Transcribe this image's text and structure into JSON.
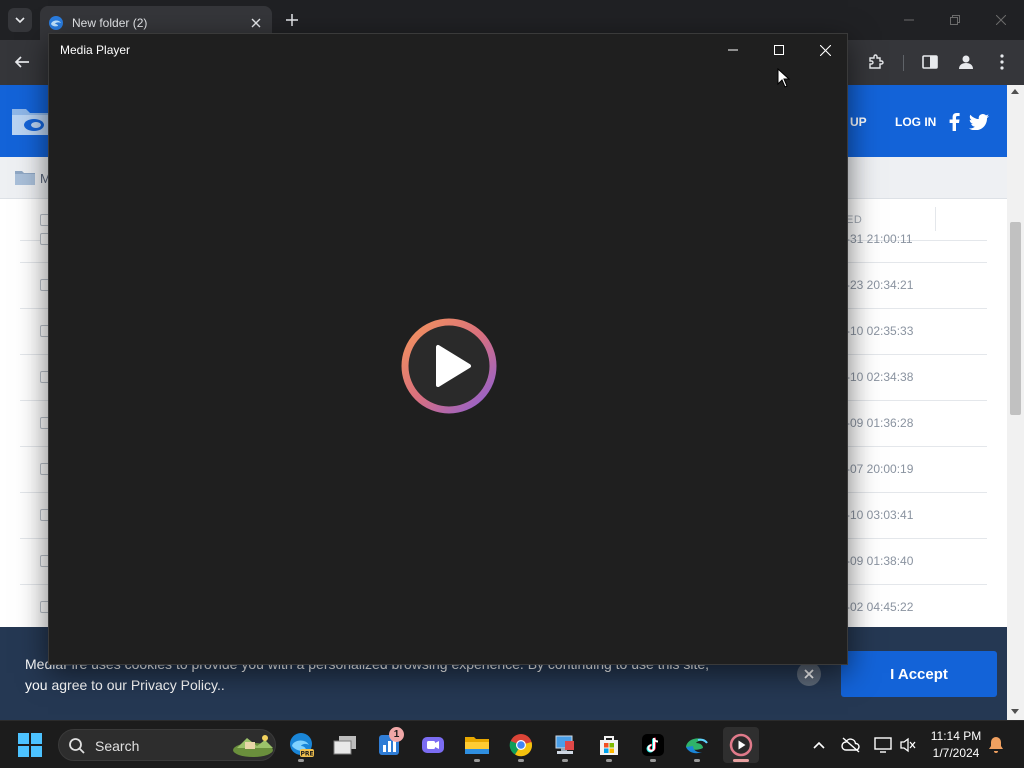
{
  "browser": {
    "tab": {
      "title": "New folder (2)"
    }
  },
  "page": {
    "header": {
      "signup": "N UP",
      "login": "LOG IN"
    },
    "breadcrumb": "M",
    "table_header": {
      "date_fragment": "ED"
    },
    "rows": [
      {
        "date": "-31 21:00:11"
      },
      {
        "date": "-23 20:34:21"
      },
      {
        "date": "-10 02:35:33"
      },
      {
        "date": "-10 02:34:38"
      },
      {
        "date": "-09 01:36:28"
      },
      {
        "date": "-07 20:00:19"
      },
      {
        "date": "-10 03:03:41"
      },
      {
        "date": "-09 01:38:40"
      },
      {
        "date": "-02 04:45:22"
      }
    ],
    "cookie": {
      "text": "MediaFire uses cookies to provide you with a personalized browsing experience. By continuing to use this site, you agree to our Privacy Policy..",
      "accept": "I Accept"
    }
  },
  "media_player": {
    "title": "Media Player"
  },
  "taskbar": {
    "search_label": "Search",
    "notification_badge": "1",
    "time": "11:14 PM",
    "date": "1/7/2024"
  },
  "colors": {
    "brand_blue": "#1363d8",
    "cookie_bg": "#253853",
    "player_bg": "#1f1f1f"
  },
  "icons": [
    "tab-list-icon",
    "edge-favicon-icon",
    "close-icon",
    "plus-icon",
    "minimize-icon",
    "maximize-icon",
    "back-arrow-icon",
    "puzzle-icon",
    "side-panel-icon",
    "profile-icon",
    "kebab-menu-icon",
    "mediafire-logo-icon",
    "facebook-icon",
    "twitter-icon",
    "folder-icon",
    "play-icon",
    "windows-icon",
    "search-icon"
  ]
}
